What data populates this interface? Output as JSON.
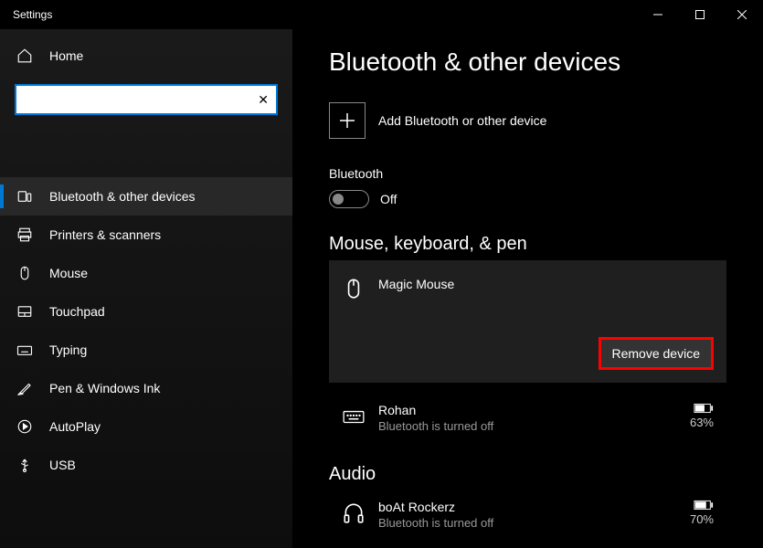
{
  "titlebar": {
    "title": "Settings"
  },
  "sidebar": {
    "home": "Home",
    "search": {
      "value": "",
      "placeholder": ""
    },
    "items": [
      {
        "label": "Bluetooth & other devices"
      },
      {
        "label": "Printers & scanners"
      },
      {
        "label": "Mouse"
      },
      {
        "label": "Touchpad"
      },
      {
        "label": "Typing"
      },
      {
        "label": "Pen & Windows Ink"
      },
      {
        "label": "AutoPlay"
      },
      {
        "label": "USB"
      }
    ]
  },
  "main": {
    "title": "Bluetooth & other devices",
    "add_label": "Add Bluetooth or other device",
    "bluetooth": {
      "label": "Bluetooth",
      "state": "Off"
    },
    "mouse_section": {
      "header": "Mouse, keyboard, & pen",
      "selected": {
        "name": "Magic Mouse",
        "remove": "Remove device"
      },
      "keyboard": {
        "name": "Rohan",
        "status": "Bluetooth is turned off",
        "battery": "63%"
      }
    },
    "audio_section": {
      "header": "Audio",
      "device": {
        "name": "boAt Rockerz",
        "status": "Bluetooth is turned off",
        "battery": "70%"
      }
    }
  }
}
